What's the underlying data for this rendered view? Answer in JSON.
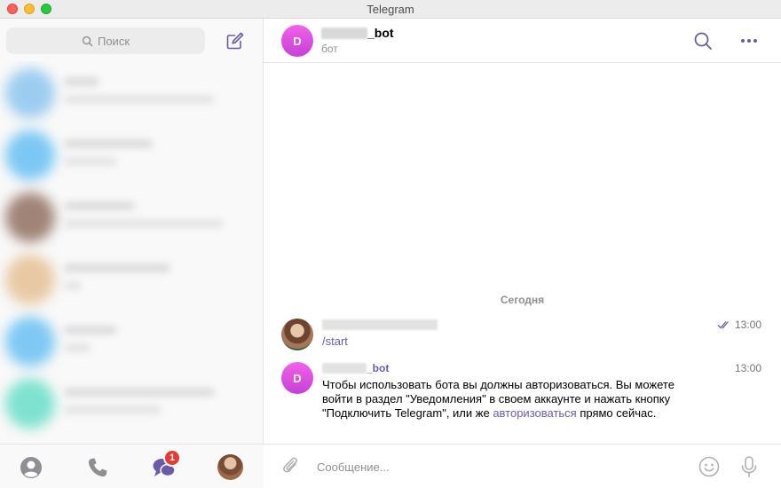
{
  "window": {
    "title": "Telegram"
  },
  "sidebar": {
    "search_placeholder": "Поиск",
    "tabs": [
      {
        "name": "contacts",
        "icon": "person-icon"
      },
      {
        "name": "calls",
        "icon": "phone-icon"
      },
      {
        "name": "chats",
        "icon": "chat-bubbles-icon",
        "badge": "1"
      },
      {
        "name": "settings",
        "icon": "avatar"
      }
    ]
  },
  "chat": {
    "header": {
      "avatar_letter": "D",
      "name_suffix": "_bot",
      "status": "бот"
    },
    "date_separator": "Сегодня",
    "messages": [
      {
        "sender": "user",
        "text": "/start",
        "time": "13:00",
        "status": "read"
      },
      {
        "sender": "bot",
        "avatar_letter": "D",
        "name_suffix": "_bot",
        "time": "13:00",
        "text_part1": "Чтобы использовать бота вы должны авторизоваться. Вы можете войти в раздел \"Уведомления\" в своем аккаунте и нажать кнопку \"Подключить Telegram\", или же ",
        "link_text": "авторизоваться",
        "text_part2": " прямо сейчас."
      }
    ],
    "input": {
      "placeholder": "Сообщение..."
    }
  },
  "colors": {
    "accent": "#6d5aa6",
    "bot_avatar": "#e04fe0",
    "badge": "#e53935"
  }
}
